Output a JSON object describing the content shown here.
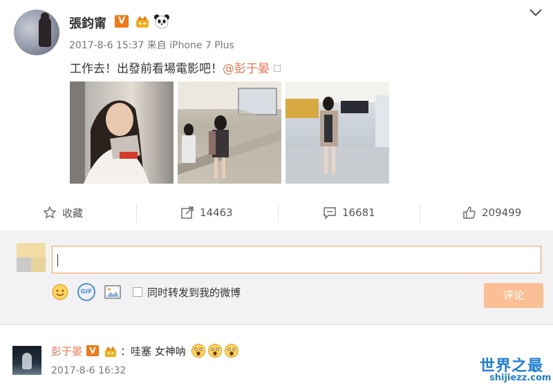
{
  "post": {
    "username": "張鈞甯",
    "verified_badge": "V",
    "timestamp": "2017-8-6 15:37",
    "source": "来自 iPhone 7 Plus",
    "text": "工作去！出發前看場電影吧！",
    "mention": "@彭于晏"
  },
  "actions": {
    "favorite_label": "收藏",
    "repost_count": "14463",
    "comment_count": "16681",
    "like_count": "209499"
  },
  "comment_box": {
    "input_value": "",
    "sync_label": "同时转发到我的微博",
    "submit_label": "评论",
    "gif_label": "GIF"
  },
  "comment": {
    "username": "彭于晏",
    "verified_badge": "V",
    "text": "：哇塞 女神呐",
    "timestamp": "2017-8-6 16:32"
  },
  "watermark": {
    "title": "世界之最",
    "domain": "shijiezz.com"
  },
  "colors": {
    "accent_orange": "#eb7350",
    "input_border": "#f0a04b",
    "submit_bg": "#fbbf95",
    "watermark_blue": "#1f7fd6"
  }
}
